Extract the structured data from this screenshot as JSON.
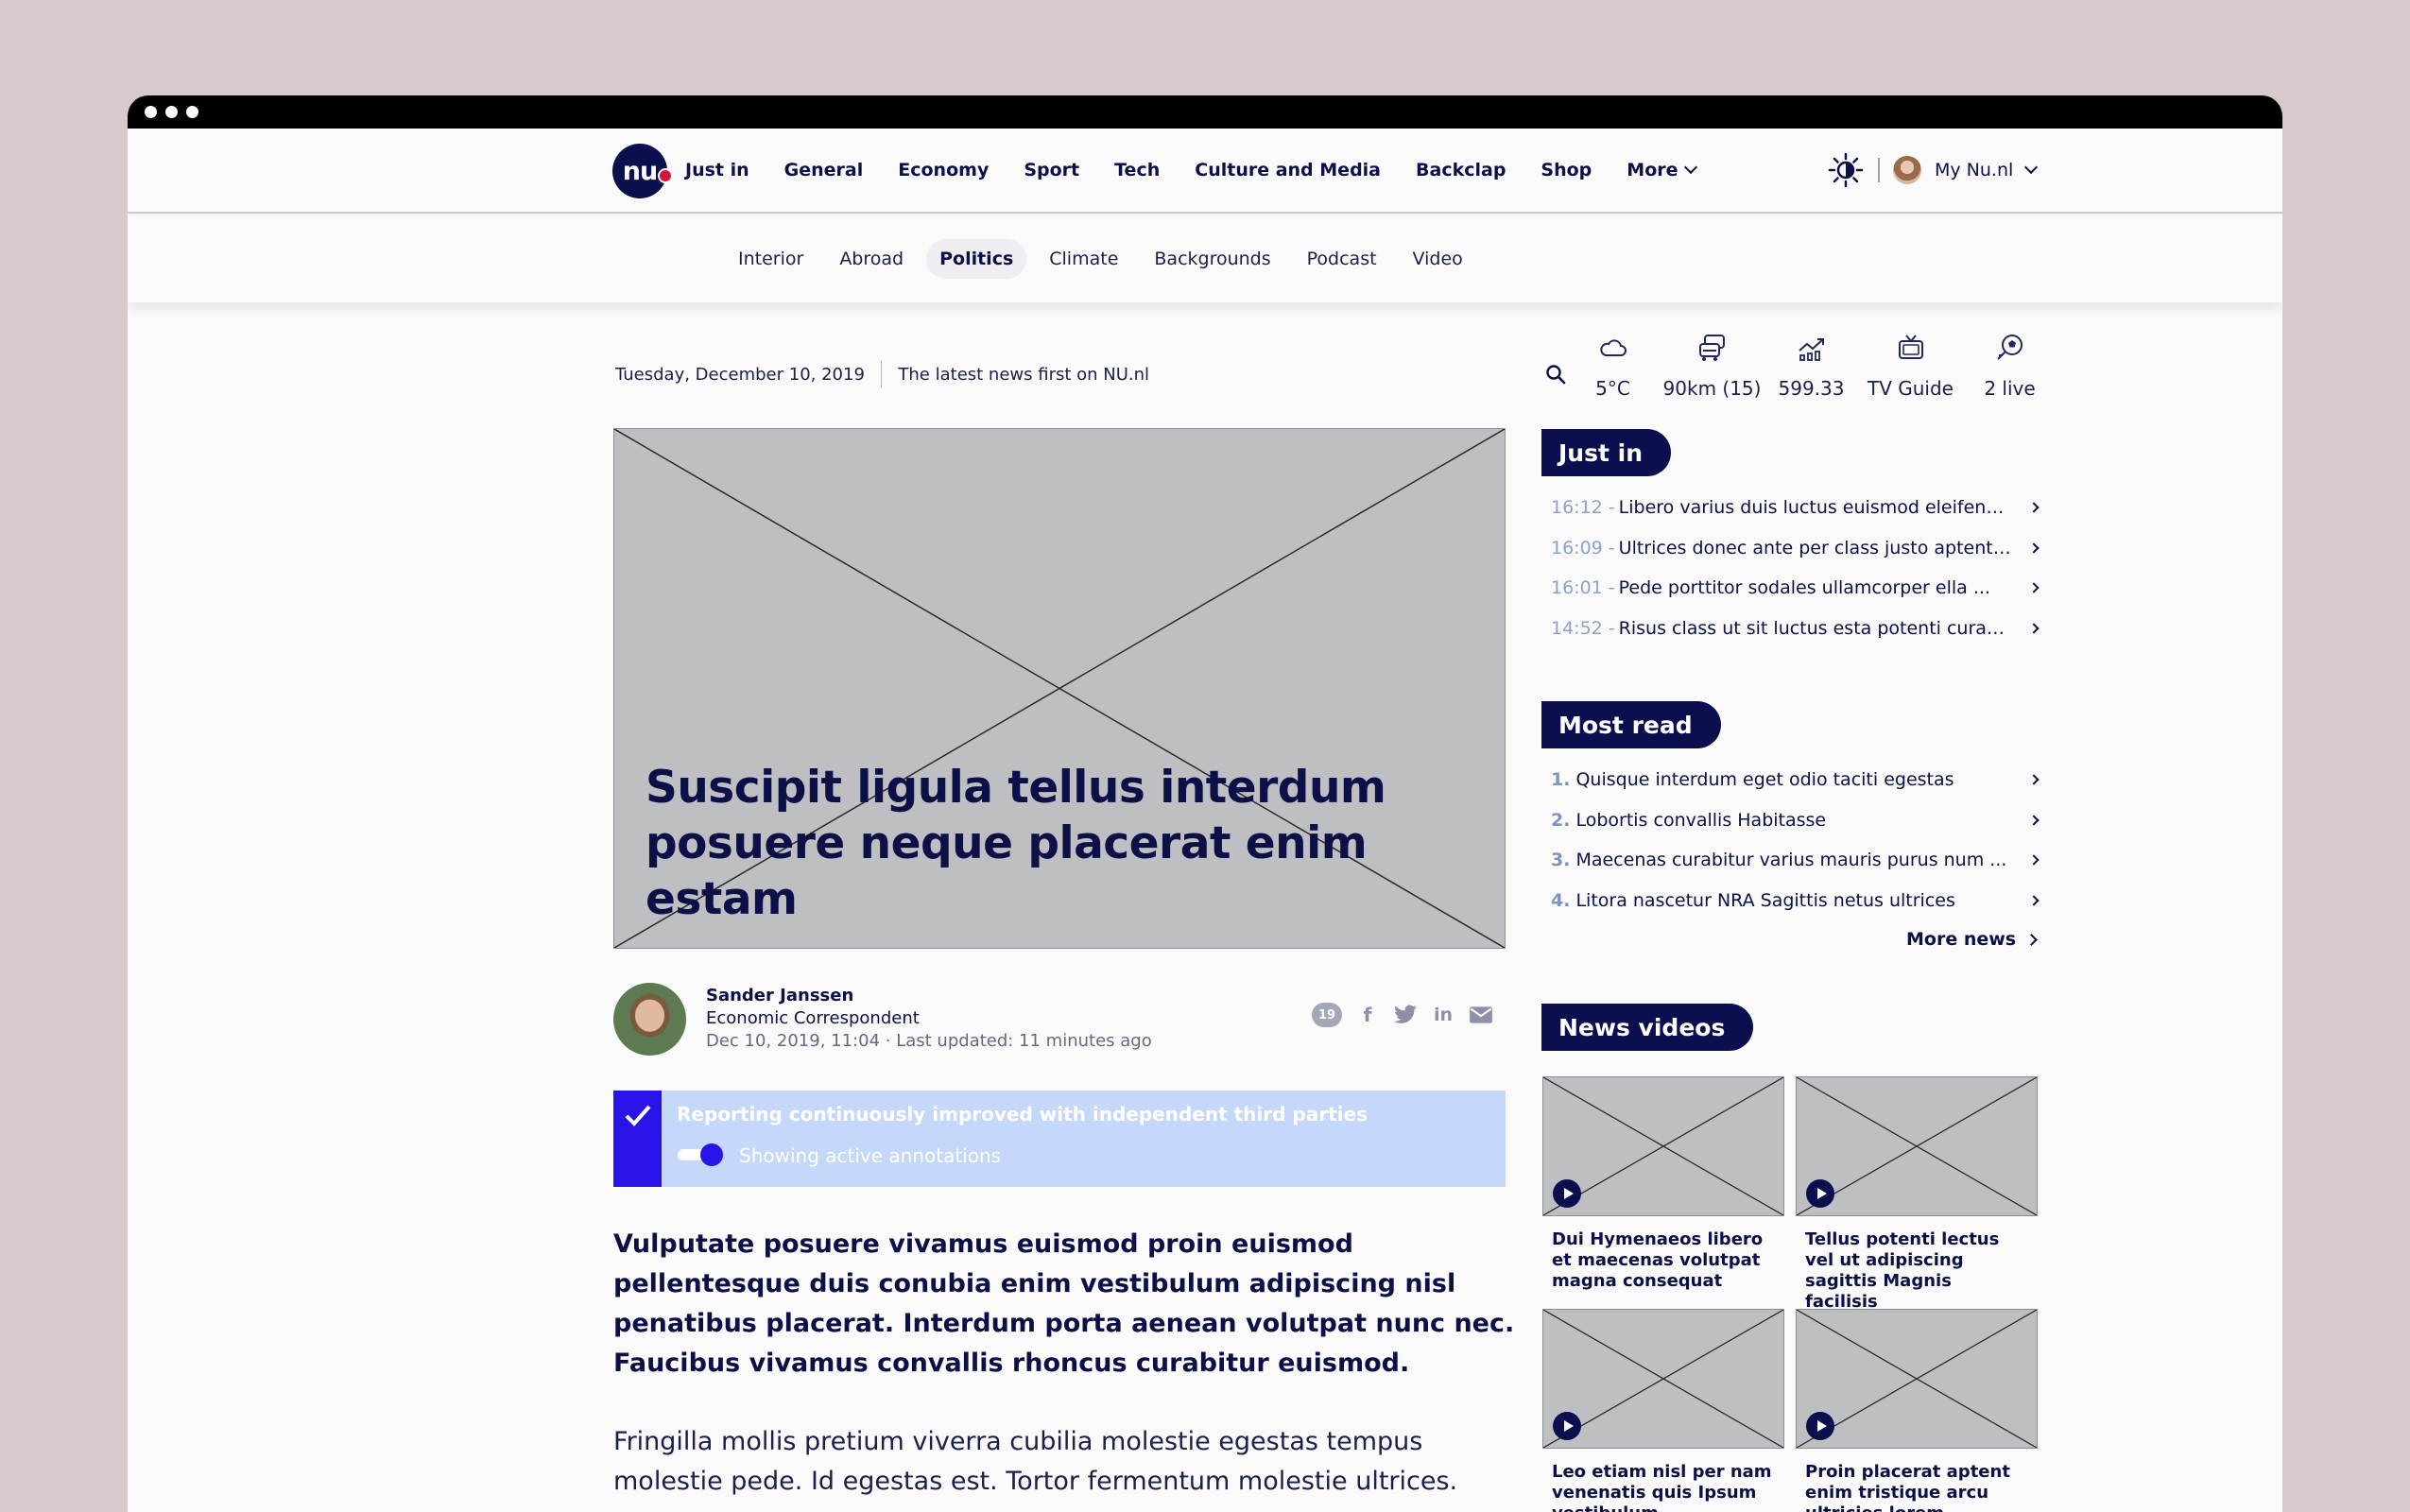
{
  "brand": {
    "logo_text": "nu"
  },
  "nav": {
    "items": [
      "Just in",
      "General",
      "Economy",
      "Sport",
      "Tech",
      "Culture and Media",
      "Backclap",
      "Shop"
    ],
    "more_label": "More",
    "user_label": "My Nu.nl"
  },
  "subnav": {
    "items": [
      "Interior",
      "Abroad",
      "Politics",
      "Climate",
      "Backgrounds",
      "Podcast",
      "Video"
    ],
    "active": "Politics"
  },
  "meta": {
    "date": "Tuesday, December 10, 2019",
    "tagline": "The latest news first on NU.nl"
  },
  "article": {
    "headline": "Suscipit ligula tellus interdum posuere neque placerat enim estam",
    "author_name": "Sander Janssen",
    "author_role": "Economic Correspondent",
    "timestamp": "Dec 10, 2019, 11:04 · Last updated: 11 minutes ago",
    "comment_count": "19",
    "annotation_title": "Reporting continuously improved with independent third parties",
    "annotation_toggle": "Showing active annotations",
    "lead": "Vulputate posuere vivamus euismod proin euismod pellentesque duis conubia enim vestibulum adipiscing nisl penatibus placerat. Interdum porta aenean volutpat nunc nec. Faucibus vivamus convallis rhoncus curabitur euismod.",
    "body": "Fringilla mollis pretium viverra cubilia molestie egestas tempus molestie pede. Id egestas est. Tortor fermentum molestie ultrices."
  },
  "widgets": [
    {
      "icon": "cloud-icon",
      "label": "5°C"
    },
    {
      "icon": "traffic-icon",
      "label": "90km (15)"
    },
    {
      "icon": "stocks-icon",
      "label": "599.33"
    },
    {
      "icon": "tv-icon",
      "label": "TV Guide"
    },
    {
      "icon": "football-icon",
      "label": "2 live"
    }
  ],
  "just_in": {
    "title": "Just in",
    "items": [
      {
        "time": "16:12 -",
        "text": "Libero varius duis luctus euismod eleifend ..."
      },
      {
        "time": "16:09 -",
        "text": "Ultrices donec ante per class justo aptent ..."
      },
      {
        "time": "16:01 -",
        "text": "Pede porttitor sodales ullamcorper ella ..."
      },
      {
        "time": "14:52 -",
        "text": "Risus class ut sit luctus esta potenti curae ..."
      }
    ]
  },
  "most_read": {
    "title": "Most read",
    "items": [
      {
        "num": "1.",
        "text": "Quisque interdum eget odio taciti egestas"
      },
      {
        "num": "2.",
        "text": "Lobortis convallis Habitasse"
      },
      {
        "num": "3.",
        "text": "Maecenas curabitur varius mauris purus num ..."
      },
      {
        "num": "4.",
        "text": "Litora nascetur NRA Sagittis netus ultrices"
      }
    ],
    "more_label": "More news"
  },
  "news_videos": {
    "title": "News videos",
    "items": [
      {
        "title": "Dui Hymenaeos libero et maecenas volutpat magna consequat"
      },
      {
        "title": "Tellus potenti lectus vel ut adipiscing sagittis Magnis facilisis"
      },
      {
        "title": "Leo etiam nisl per nam venenatis quis Ipsum vestibulum"
      },
      {
        "title": "Proin placerat aptent enim tristique arcu ultricies lorem"
      }
    ]
  },
  "colors": {
    "brand_navy": "#0c0f4e",
    "accent_blue": "#2a13e8",
    "annotation_bg": "#c5d8fa"
  }
}
